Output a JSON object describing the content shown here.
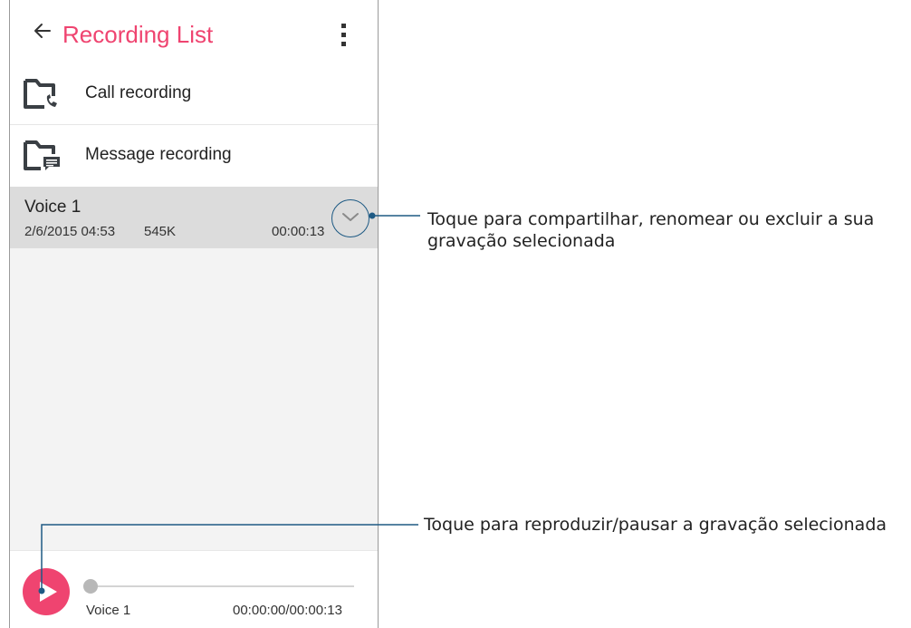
{
  "app_bar": {
    "title": "Recording List",
    "back_icon": "arrow-left-icon",
    "menu_icon": "more-vertical-icon"
  },
  "folders": [
    {
      "label": "Call recording",
      "icon": "call-recording-folder-icon"
    },
    {
      "label": "Message recording",
      "icon": "message-recording-folder-icon"
    }
  ],
  "recordings": [
    {
      "name": "Voice 1",
      "date": "2/6/2015 04:53",
      "size": "545K",
      "duration": "00:00:13",
      "action_icon": "chevron-down-icon"
    }
  ],
  "player": {
    "name": "Voice 1",
    "time": "00:00:00/00:00:13",
    "progress": 0,
    "play_icon": "play-icon"
  },
  "callouts": {
    "expand": "Toque para compartilhar, renomear ou excluir a sua gravação selecionada",
    "play": "Toque para reproduzir/pausar a gravação selecionada"
  },
  "colors": {
    "accent": "#ef4470",
    "callout_line": "#1e5a84",
    "selected_row": "#dcdcdc",
    "list_background": "#f3f3f3"
  }
}
